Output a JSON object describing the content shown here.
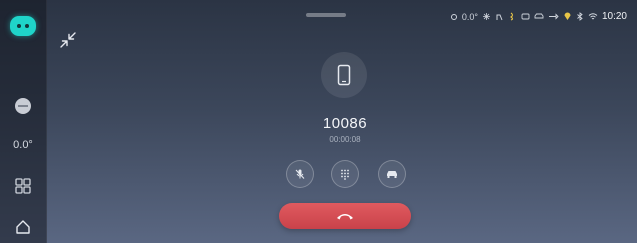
{
  "sidebar": {
    "temperature": "0.0°",
    "accent_color": "#1fd4c9"
  },
  "status_bar": {
    "temperature": "0.0°",
    "time": "10:20",
    "icons": [
      "weather-icon",
      "fan-icon",
      "seat-heat-icon",
      "steering-heat-icon",
      "defrost-icon",
      "car-icon",
      "usb-icon",
      "location-icon",
      "wifi-icon",
      "bluetooth-icon"
    ]
  },
  "call": {
    "number": "10086",
    "duration": "00:00:08",
    "hangup_color": "#d84c53"
  },
  "controls": [
    "mute-mic-icon",
    "keypad-icon",
    "car-audio-icon"
  ]
}
